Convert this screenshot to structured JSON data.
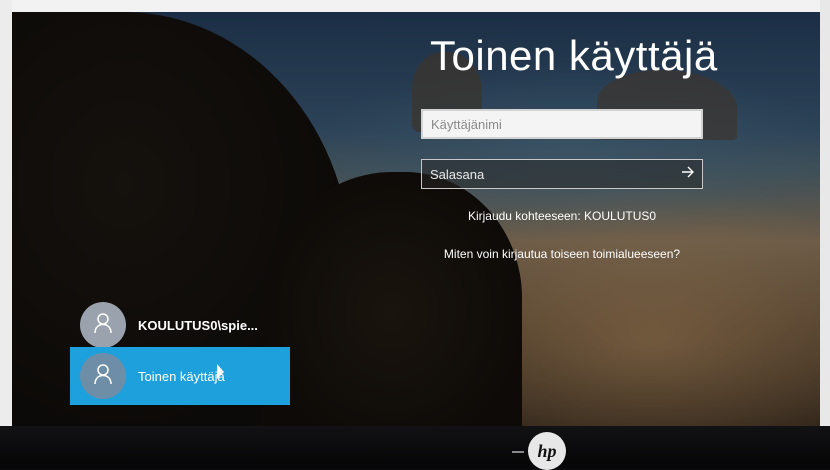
{
  "login": {
    "title": "Toinen käyttäjä",
    "username_placeholder": "Käyttäjänimi",
    "password_placeholder": "Salasana",
    "submit_icon": "arrow-right-icon",
    "signin_to": "Kirjaudu kohteeseen: KOULUTUS0",
    "other_domain_link": "Miten voin kirjautua toiseen toimialueeseen?"
  },
  "users": [
    {
      "label": "KOULUTUS0\\spie...",
      "icon": "user-icon",
      "selected": false
    },
    {
      "label": "Toinen käyttäjä",
      "icon": "user-icon",
      "selected": true
    }
  ],
  "monitor": {
    "brand": "hp"
  },
  "colors": {
    "selected_tile": "#1ea0dc",
    "title_text": "#ffffff"
  }
}
